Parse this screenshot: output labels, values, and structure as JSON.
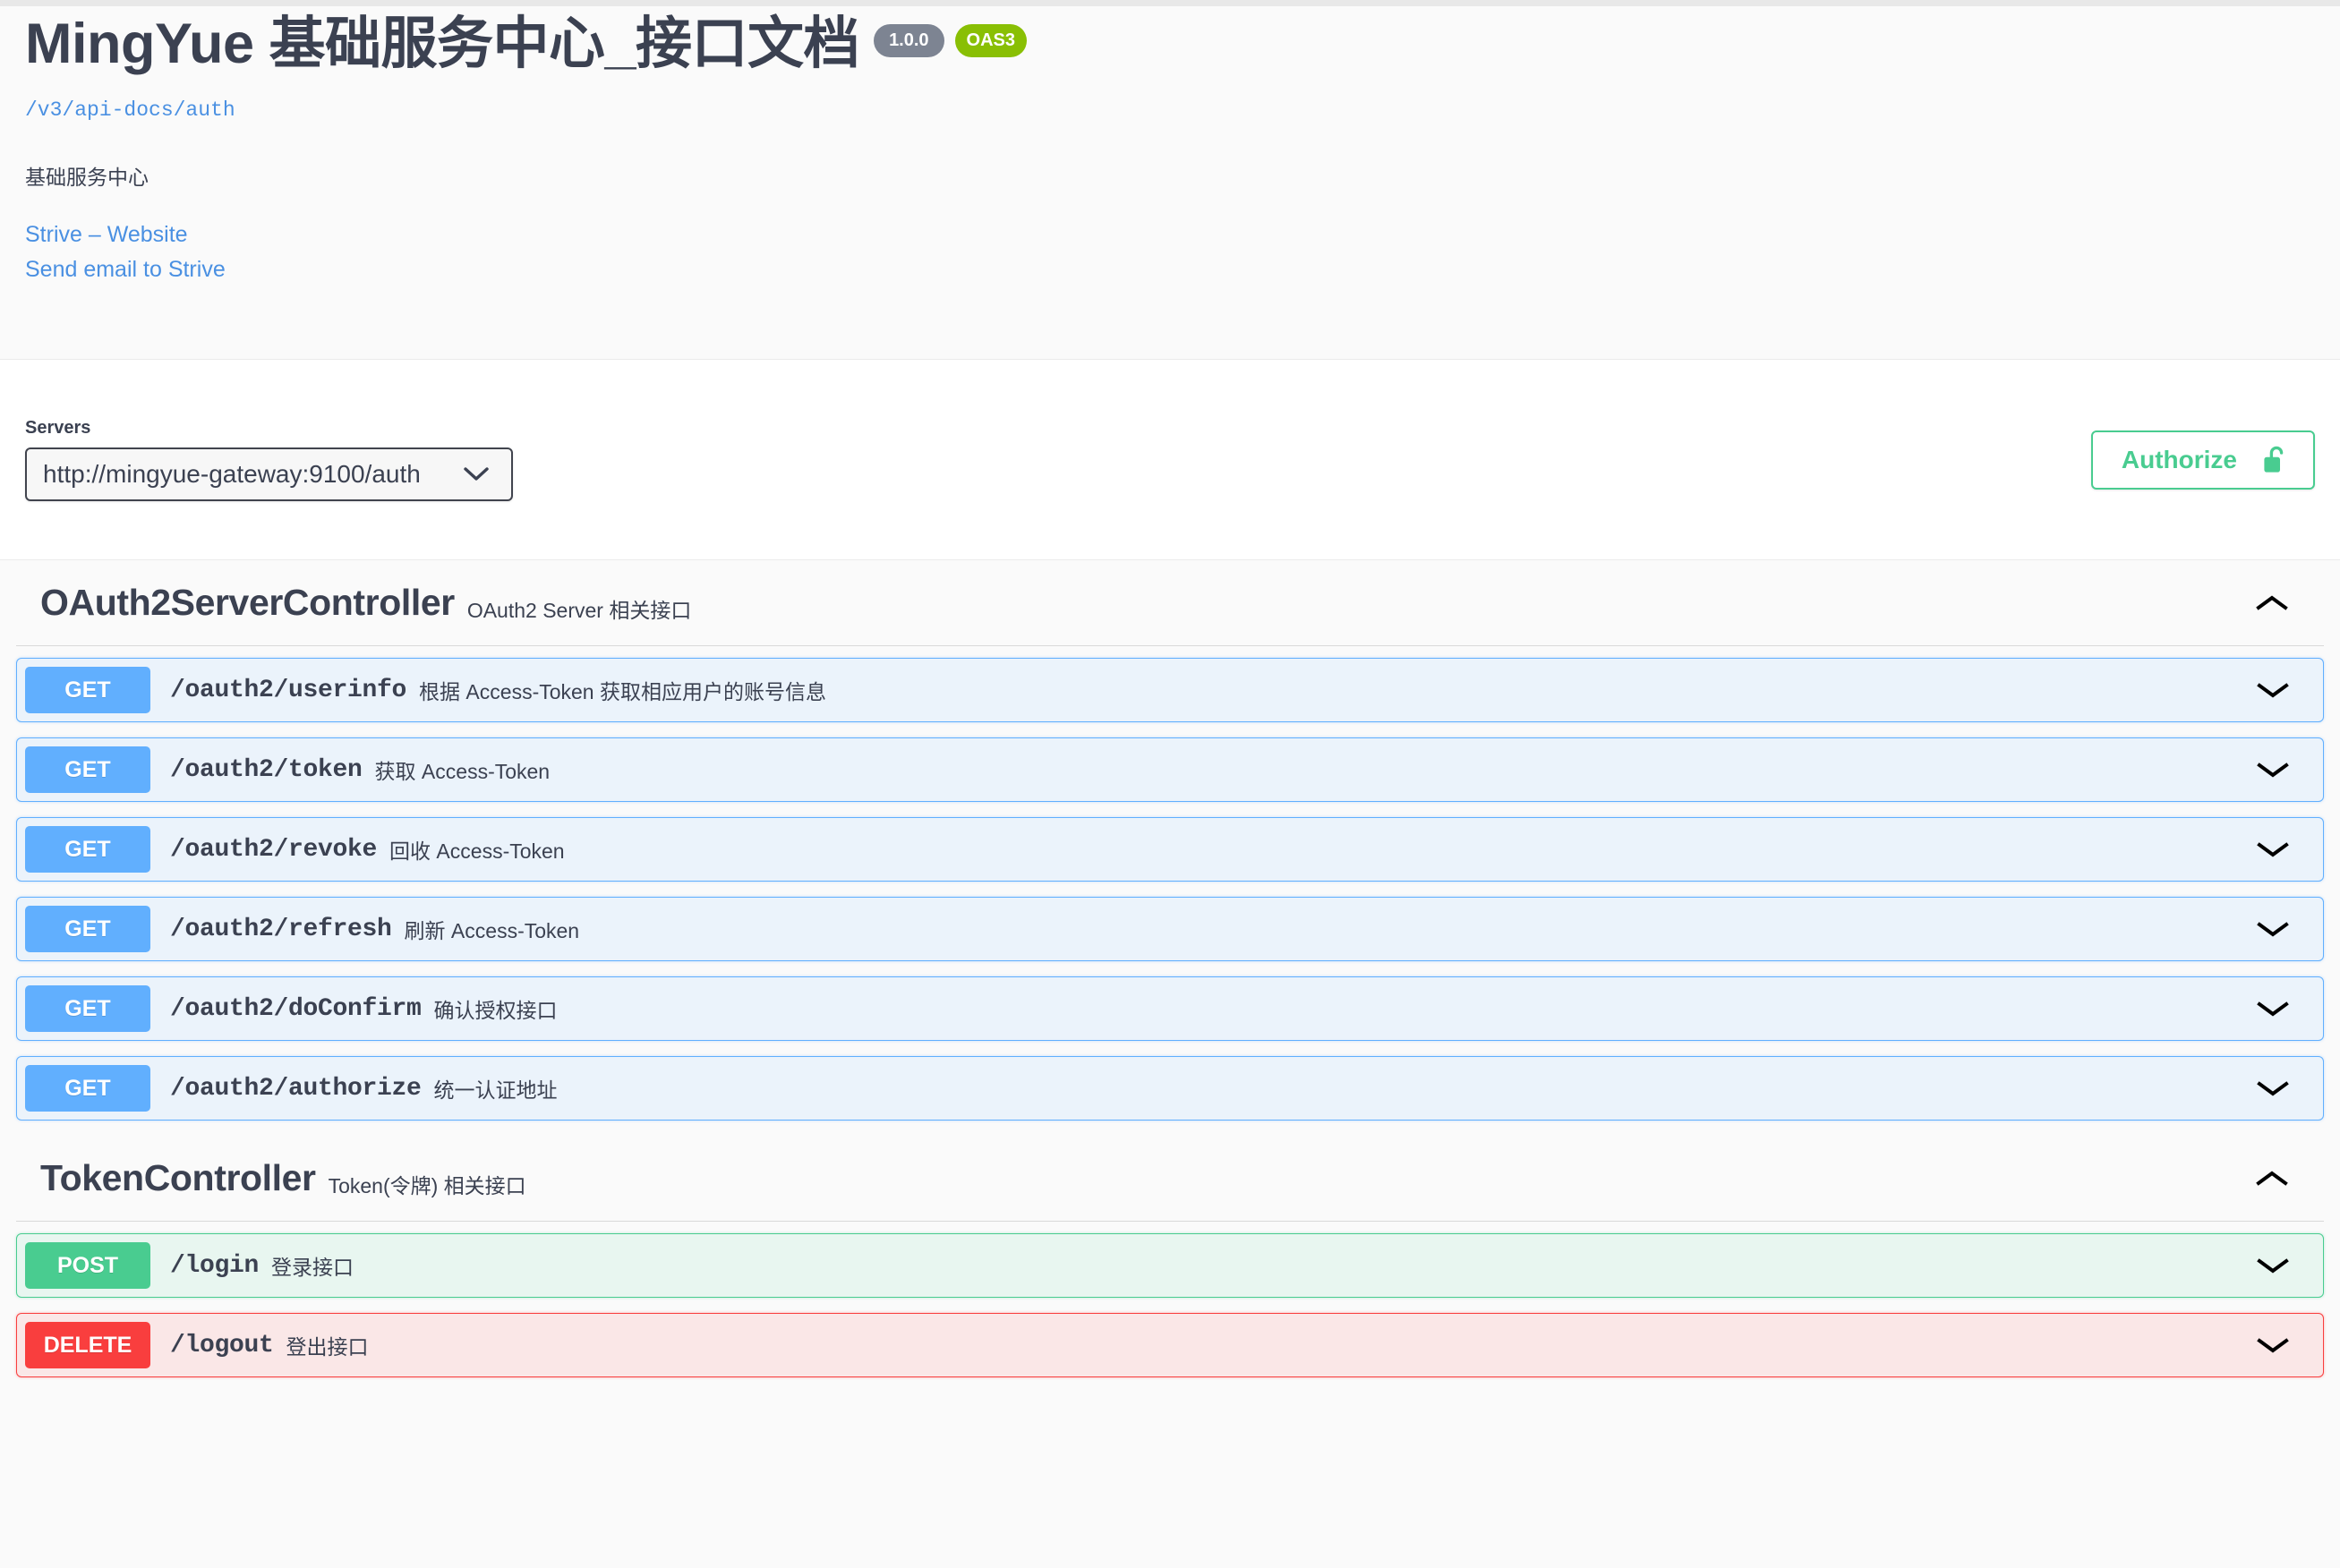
{
  "header": {
    "title": "MingYue 基础服务中心_接口文档",
    "version_badge": "1.0.0",
    "spec_badge": "OAS3",
    "docs_url": "/v3/api-docs/auth",
    "description": "基础服务中心",
    "links": [
      {
        "label": "Strive – Website"
      },
      {
        "label": "Send email to Strive"
      }
    ]
  },
  "scheme": {
    "servers_label": "Servers",
    "selected_server": "http://mingyue-gateway:9100/auth",
    "authorize_label": "Authorize",
    "lock_icon": "unlocked-padlock-icon",
    "chevron_icon": "chevron-down-icon"
  },
  "sections": [
    {
      "name": "OAuth2ServerController",
      "description": "OAuth2 Server 相关接口",
      "expanded": true,
      "toggle_icon": "chevron-up-icon",
      "operations": [
        {
          "method": "GET",
          "path": "/oauth2/userinfo",
          "summary": "根据 Access-Token 获取相应用户的账号信息"
        },
        {
          "method": "GET",
          "path": "/oauth2/token",
          "summary": "获取 Access-Token"
        },
        {
          "method": "GET",
          "path": "/oauth2/revoke",
          "summary": "回收 Access-Token"
        },
        {
          "method": "GET",
          "path": "/oauth2/refresh",
          "summary": "刷新 Access-Token"
        },
        {
          "method": "GET",
          "path": "/oauth2/doConfirm",
          "summary": "确认授权接口"
        },
        {
          "method": "GET",
          "path": "/oauth2/authorize",
          "summary": "统一认证地址"
        }
      ]
    },
    {
      "name": "TokenController",
      "description": "Token(令牌) 相关接口",
      "expanded": true,
      "toggle_icon": "chevron-up-icon",
      "operations": [
        {
          "method": "POST",
          "path": "/login",
          "summary": "登录接口"
        },
        {
          "method": "DELETE",
          "path": "/logout",
          "summary": "登出接口"
        }
      ]
    }
  ],
  "colors": {
    "get": "#61affe",
    "post": "#49cc90",
    "delete": "#f93e3e",
    "version_badge": "#7d8492",
    "oas_badge": "#89bf04",
    "link": "#4a90e2",
    "text": "#3b4151"
  }
}
